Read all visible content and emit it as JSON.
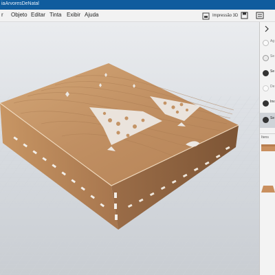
{
  "window": {
    "title_fragment": "iaArvoresDeNatal"
  },
  "menu": {
    "items": [
      {
        "label": "r"
      },
      {
        "label": "Objeto"
      },
      {
        "label": "Editar"
      },
      {
        "label": "Tinta"
      },
      {
        "label": "Exibir"
      },
      {
        "label": "Ajuda"
      }
    ],
    "print_3d_label": "Impressão 3D"
  },
  "panel": {
    "rows": [
      {
        "text": "Ag"
      },
      {
        "text": "Se"
      },
      {
        "text": "Se"
      },
      {
        "text": "De"
      },
      {
        "text": "Inv"
      },
      {
        "text": "Se"
      }
    ],
    "section_label": "Itens"
  },
  "colors": {
    "title_bar": "#0f5c9e",
    "wood_light": "#c89a6d",
    "wood_dark": "#8e6443",
    "accent": "#2b8be6"
  }
}
